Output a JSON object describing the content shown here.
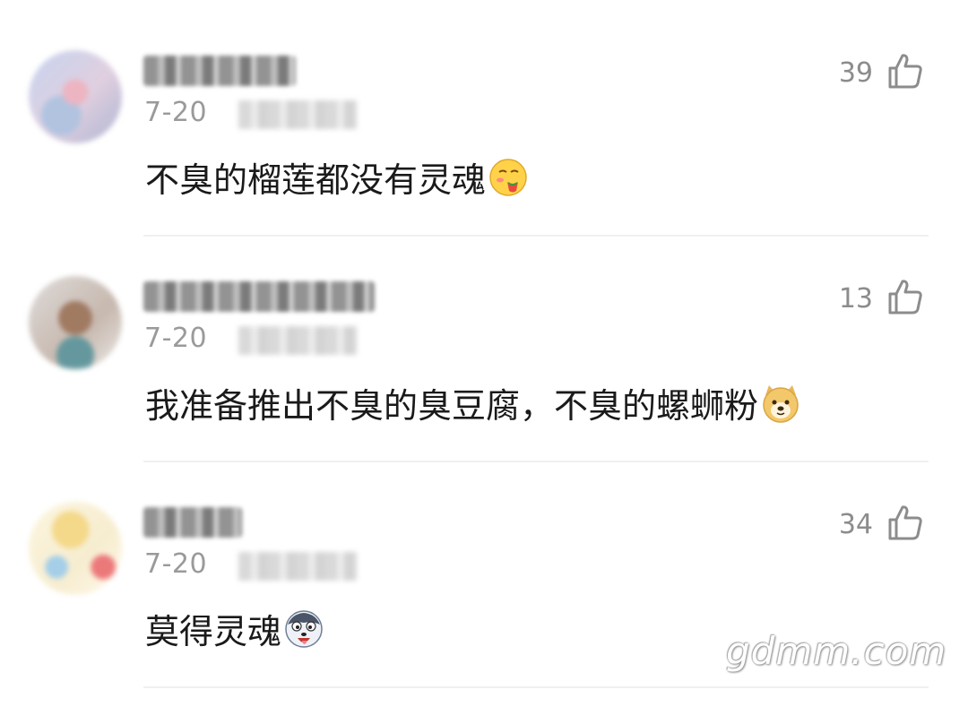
{
  "comments": [
    {
      "date": "7-20",
      "likes": "39",
      "text": "不臭的榴莲都没有灵魂",
      "emoji": "yum-face-emoji"
    },
    {
      "date": "7-20",
      "likes": "13",
      "text": "我准备推出不臭的臭豆腐，不臭的螺蛳粉",
      "emoji": "doge-emoji"
    },
    {
      "date": "7-20",
      "likes": "34",
      "text": "莫得灵魂",
      "emoji": "husky-emoji"
    }
  ],
  "watermark": "gdmm.com",
  "icons": {
    "like": "thumbs-up-icon"
  },
  "colors": {
    "text": "#1a1a1a",
    "meta": "#9a9a9a",
    "likes": "#8c8c8c",
    "divider": "#f0f0f0"
  }
}
